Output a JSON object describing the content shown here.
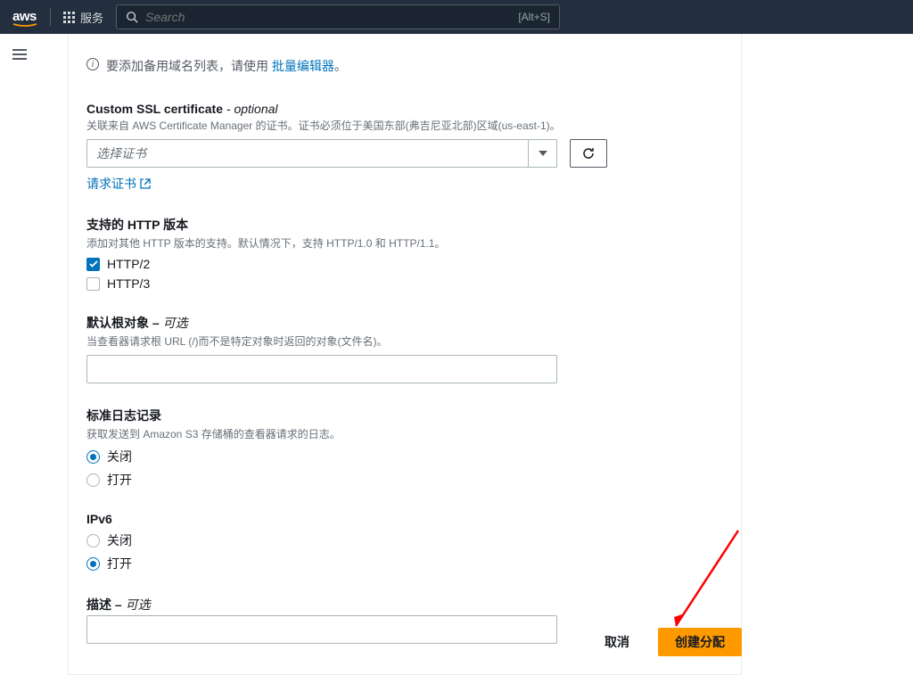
{
  "topbar": {
    "services_label": "服务",
    "search_placeholder": "Search",
    "search_hint": "[Alt+S]"
  },
  "info_banner": {
    "prefix": "要添加备用域名列表，请使用 ",
    "link": "批量编辑器",
    "suffix": "。"
  },
  "ssl": {
    "label": "Custom SSL certificate",
    "optional": "- optional",
    "help": "关联来自 AWS Certificate Manager 的证书。证书必须位于美国东部(弗吉尼亚北部)区域(us-east-1)。",
    "placeholder": "选择证书",
    "request_link": "请求证书"
  },
  "http": {
    "label": "支持的 HTTP 版本",
    "help": "添加对其他 HTTP 版本的支持。默认情况下，支持 HTTP/1.0 和 HTTP/1.1。",
    "opt1": "HTTP/2",
    "opt2": "HTTP/3"
  },
  "root": {
    "label": "默认根对象 – ",
    "optional": "可选",
    "help": "当查看器请求根 URL (/)而不是特定对象时返回的对象(文件名)。"
  },
  "logging": {
    "label": "标准日志记录",
    "help": "获取发送到 Amazon S3 存储桶的查看器请求的日志。",
    "off": "关闭",
    "on": "打开"
  },
  "ipv6": {
    "label": "IPv6",
    "off": "关闭",
    "on": "打开"
  },
  "desc": {
    "label": "描述 – ",
    "optional": "可选"
  },
  "footer": {
    "cancel": "取消",
    "create": "创建分配"
  }
}
